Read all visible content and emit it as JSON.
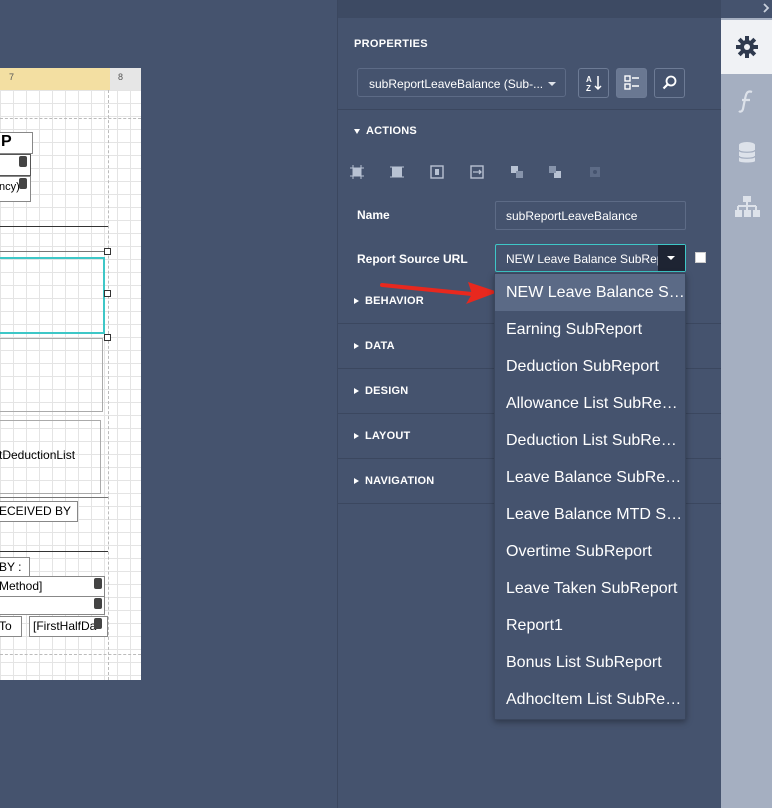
{
  "ruler": {
    "marks": [
      "7",
      "8"
    ]
  },
  "report": {
    "header_text": "P",
    "field_currency": "ncy)",
    "deduction_list": "tDeductionList",
    "received_by": "ECEIVED BY",
    "approved_by": "BY :",
    "method": "Method]",
    "to_label": "To",
    "first_half": "[FirstHalfDa"
  },
  "panel": {
    "title": "PROPERTIES",
    "component_select": "subReportLeaveBalance (Sub-...",
    "actions_label": "ACTIONS",
    "name_label": "Name",
    "name_value": "subReportLeaveBalance",
    "url_label": "Report Source URL",
    "url_value": "NEW Leave Balance SubReport",
    "sections": [
      "BEHAVIOR",
      "DATA",
      "DESIGN",
      "LAYOUT",
      "NAVIGATION"
    ]
  },
  "dropdown": {
    "options": [
      "NEW Leave Balance SubReport",
      "Earning SubReport",
      "Deduction SubReport",
      "Allowance List SubReport",
      "Deduction List SubReport",
      "Leave Balance SubReport",
      "Leave Balance MTD SubReport",
      "Overtime SubReport",
      "Leave Taken SubReport",
      "Report1",
      "Bonus List SubReport",
      "AdhocItem List SubReport"
    ],
    "selected_index": 0
  },
  "iconbar": {
    "items": [
      "gear-icon",
      "function-icon",
      "database-icon",
      "hierarchy-icon"
    ],
    "active": "gear-icon"
  },
  "colors": {
    "panel_bg": "#45536e",
    "accent_border": "#3ec7c7",
    "arrow": "#e8281e",
    "iconbar_bg": "#a5afc1"
  }
}
